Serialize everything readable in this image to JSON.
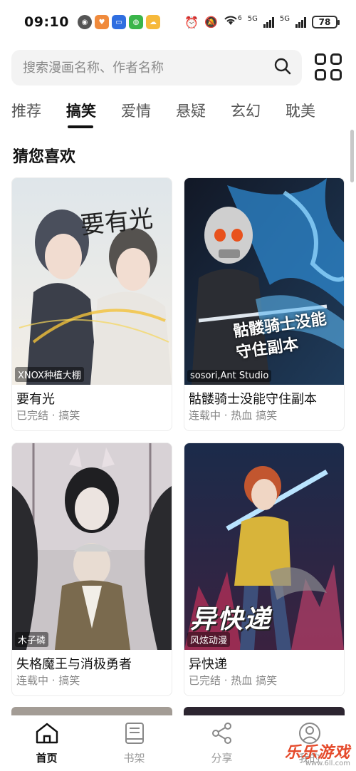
{
  "status": {
    "time": "09:10",
    "net1": "6",
    "net2": "5G",
    "net3": "5G",
    "battery": "78"
  },
  "search": {
    "placeholder": "搜索漫画名称、作者名称"
  },
  "tabs": [
    {
      "label": "推荐"
    },
    {
      "label": "搞笑"
    },
    {
      "label": "爱情"
    },
    {
      "label": "悬疑"
    },
    {
      "label": "玄幻"
    },
    {
      "label": "耽美"
    }
  ],
  "active_tab": "搞笑",
  "section": {
    "title": "猜您喜欢"
  },
  "cards": [
    {
      "author": "XNOX种植大棚",
      "title": "要有光",
      "meta": "已完结 · 搞笑",
      "cover_text": "要有光"
    },
    {
      "author": "sosori,Ant Studio",
      "title": "骷髅骑士没能守住副本",
      "meta": "连载中 · 热血 搞笑",
      "cover_text": "骷髅骑士没能守住副本"
    },
    {
      "author": "木子磷",
      "title": "失格魔王与消极勇者",
      "meta": "连载中 · 搞笑"
    },
    {
      "author": "风炫动漫",
      "title": "异快递",
      "meta": "已完结 · 热血 搞笑",
      "cover_text": "异快递"
    }
  ],
  "nav": [
    {
      "label": "首页",
      "icon": "home-icon"
    },
    {
      "label": "书架",
      "icon": "book-icon"
    },
    {
      "label": "分享",
      "icon": "share-icon"
    },
    {
      "label": "我的",
      "icon": "profile-icon"
    }
  ],
  "watermark": {
    "main": "乐乐游戏",
    "sub": "www.6ll.com"
  }
}
